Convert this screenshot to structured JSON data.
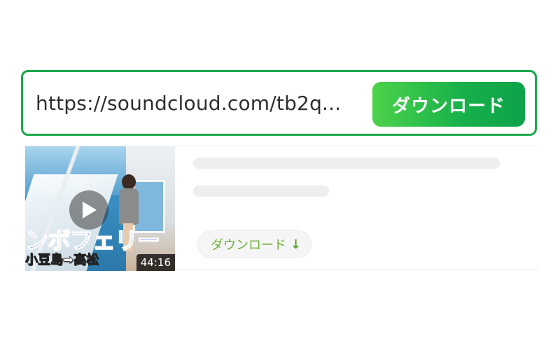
{
  "search": {
    "url_value": "https://soundcloud.com/tb2q...",
    "download_label": "ダウンロード",
    "accent_color": "#1aa84b"
  },
  "result": {
    "thumbnail": {
      "caption_main": "ンボフェリー",
      "caption_sub": "小豆島➡高松",
      "duration": "44:16",
      "play_icon": "play-icon"
    },
    "download_label": "ダウンロード",
    "download_icon": "arrow-down-icon",
    "download_arrow": "↓"
  }
}
